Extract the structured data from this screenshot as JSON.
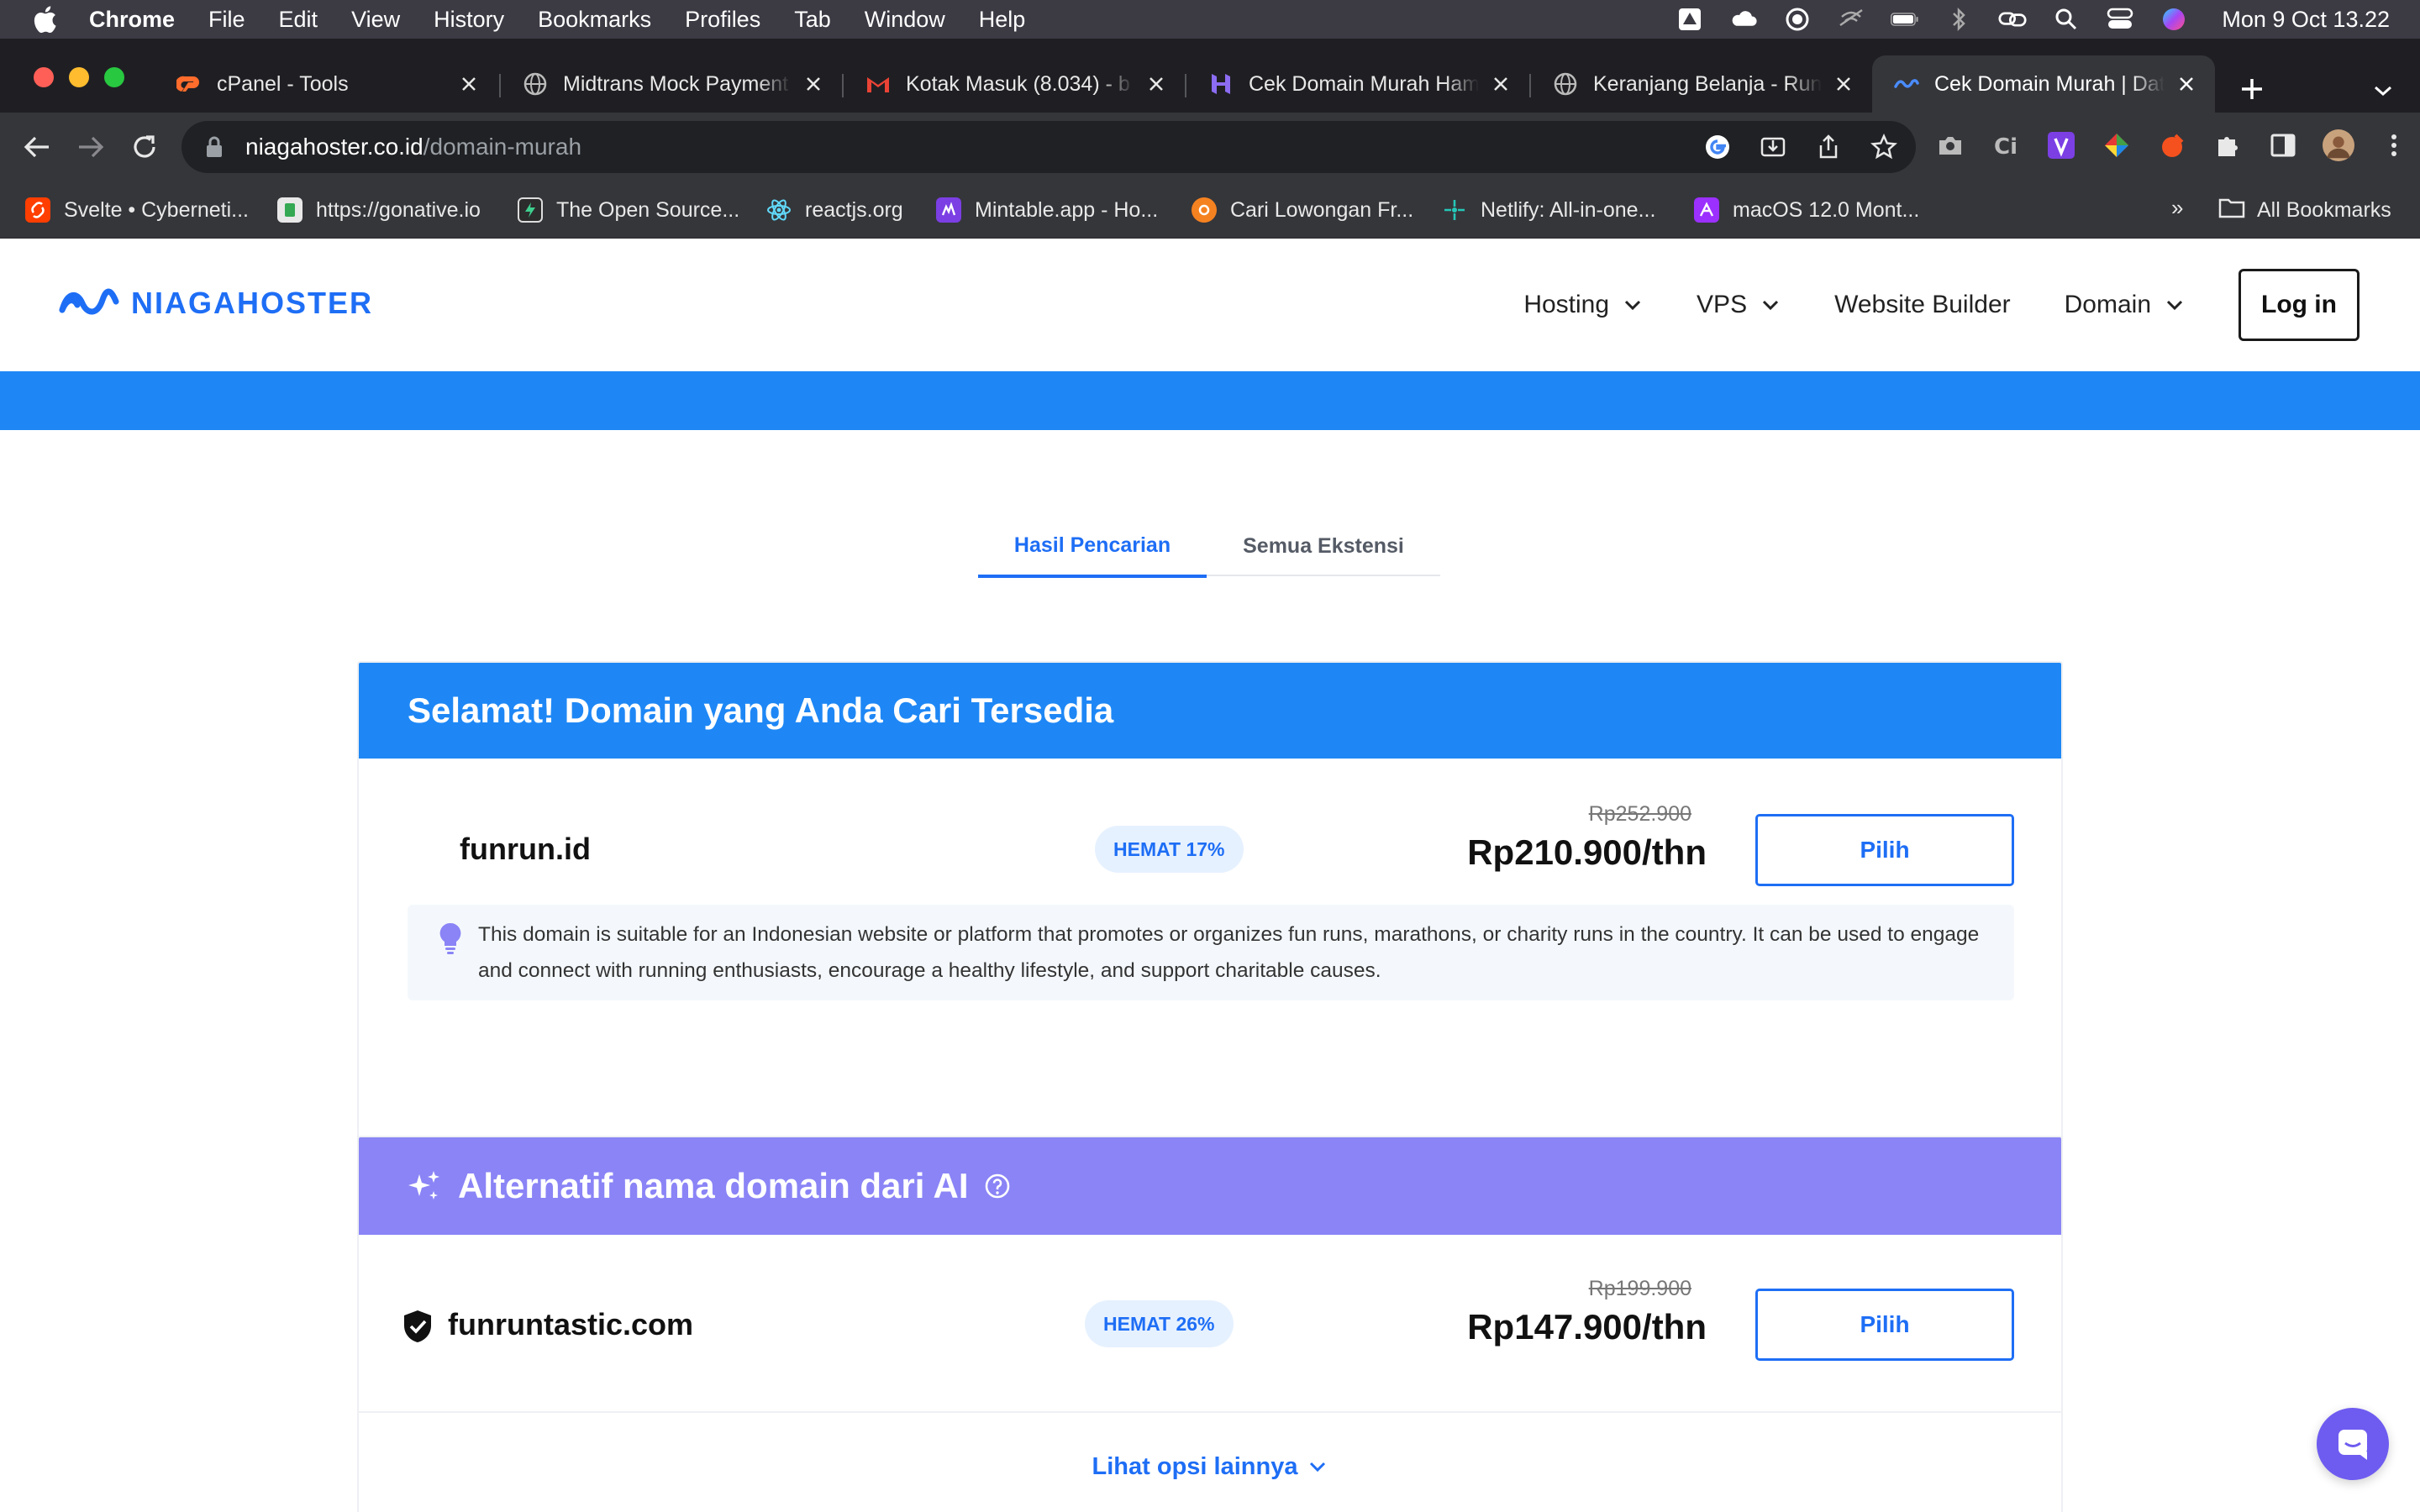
{
  "menubar": {
    "app_name": "Chrome",
    "items": [
      "File",
      "Edit",
      "View",
      "History",
      "Bookmarks",
      "Profiles",
      "Tab",
      "Window",
      "Help"
    ],
    "clock": "Mon 9 Oct  13.22"
  },
  "tabs": [
    {
      "title": "cPanel - Tools",
      "icon": "cpanel-icon"
    },
    {
      "title": "Midtrans Mock Payment",
      "icon": "globe-icon"
    },
    {
      "title": "Kotak Masuk (8.034) - b",
      "icon": "gmail-icon"
    },
    {
      "title": "Cek Domain Murah Ham",
      "icon": "hostinger-icon"
    },
    {
      "title": "Keranjang Belanja - Run",
      "icon": "globe-icon"
    },
    {
      "title": "Cek Domain Murah | Dat",
      "icon": "niagahoster-icon",
      "active": true
    }
  ],
  "omnibox": {
    "host": "niagahoster.co.id",
    "path": "/domain-murah"
  },
  "bookmarks": [
    {
      "label": "Svelte • Cyberneti...",
      "color": "#ff3e00"
    },
    {
      "label": "https://gonative.io",
      "color": "#e8e8e8"
    },
    {
      "label": "The Open Source...",
      "color": "#2c2c2c"
    },
    {
      "label": "reactjs.org",
      "color": "#61dafb"
    },
    {
      "label": "Mintable.app - Ho...",
      "color": "#7b3fe4"
    },
    {
      "label": "Cari Lowongan Fr...",
      "color": "#f58220"
    },
    {
      "label": "Netlify: All-in-one...",
      "color": "#25c7b7"
    },
    {
      "label": "macOS 12.0 Mont...",
      "color": "#9b30ff"
    }
  ],
  "bookmarks_more": "»",
  "bookmarks_all": "All Bookmarks",
  "site": {
    "logo": "NIAGAHOSTER",
    "nav": [
      "Hosting",
      "VPS",
      "Website Builder",
      "Domain"
    ],
    "login": "Log in",
    "brand_color": "#1e87f5"
  },
  "result_tabs": {
    "active": "Hasil Pencarian",
    "inactive": "Semua Ekstensi"
  },
  "available": {
    "heading": "Selamat! Domain yang Anda Cari Tersedia",
    "domain": "funrun.id",
    "badge": "HEMAT 17%",
    "old_price": "Rp252.900",
    "price": "Rp210.900/thn",
    "button": "Pilih",
    "description": "This domain is suitable for an Indonesian website or platform that promotes or organizes fun runs, marathons, or charity runs in the country. It can be used to engage and connect with running enthusiasts, encourage a healthy lifestyle, and support charitable causes."
  },
  "ai": {
    "heading": "Alternatif nama domain dari AI",
    "domain": "funruntastic.com",
    "badge": "HEMAT 26%",
    "old_price": "Rp199.900",
    "price": "Rp147.900/thn",
    "button": "Pilih",
    "more": "Lihat opsi lainnya"
  }
}
